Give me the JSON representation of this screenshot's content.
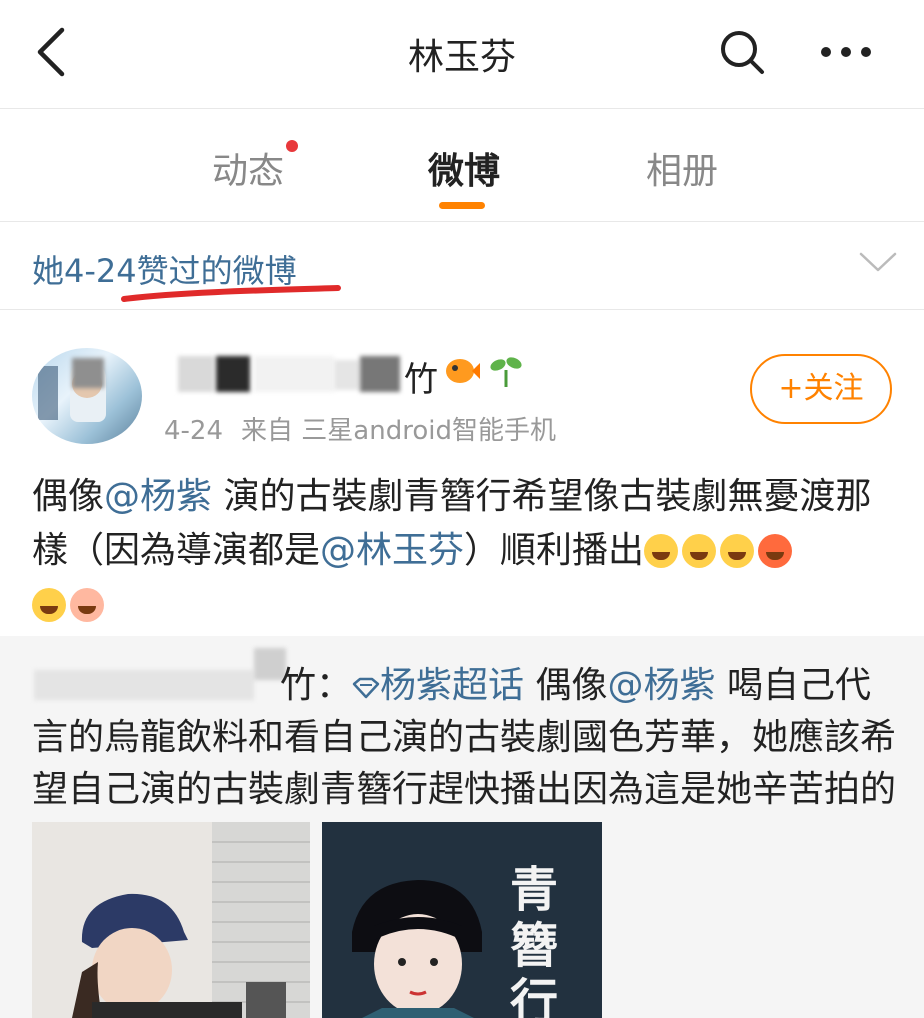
{
  "nav": {
    "title": "林玉芬",
    "back_icon": "chevron-left-icon",
    "search_icon": "search-icon",
    "more_icon": "more-dots-icon"
  },
  "tabs": [
    {
      "label": "动态",
      "has_dot": true
    },
    {
      "label": "微博",
      "active": true
    },
    {
      "label": "相册"
    }
  ],
  "accent_color": "#ff8200",
  "link_color": "#3f6e96",
  "filter": {
    "label": "她4-24赞过的微博"
  },
  "post": {
    "username_visible": "竹",
    "time": "4-24",
    "source": "来自 三星android智能手机",
    "follow_label": "+关注",
    "text": {
      "p1": "偶像",
      "m1": "@杨紫",
      "p2": " 演的古裝劇青簪行希望像古裝劇無憂渡那樣（因為導演都是",
      "m2": "@林玉芬",
      "p3": "）順利播出"
    }
  },
  "repost": {
    "author_visible": "竹",
    "sep": "：",
    "topic": "杨紫超话",
    "p1": " 偶像",
    "mention": "@杨紫",
    "p2": " 喝自己代言的烏龍飲料和看自己演的古裝劇國色芳華，她應該希望自己演的古裝劇青簪行趕快播出因為這是她辛苦拍的",
    "img2_title": "青簪行"
  }
}
